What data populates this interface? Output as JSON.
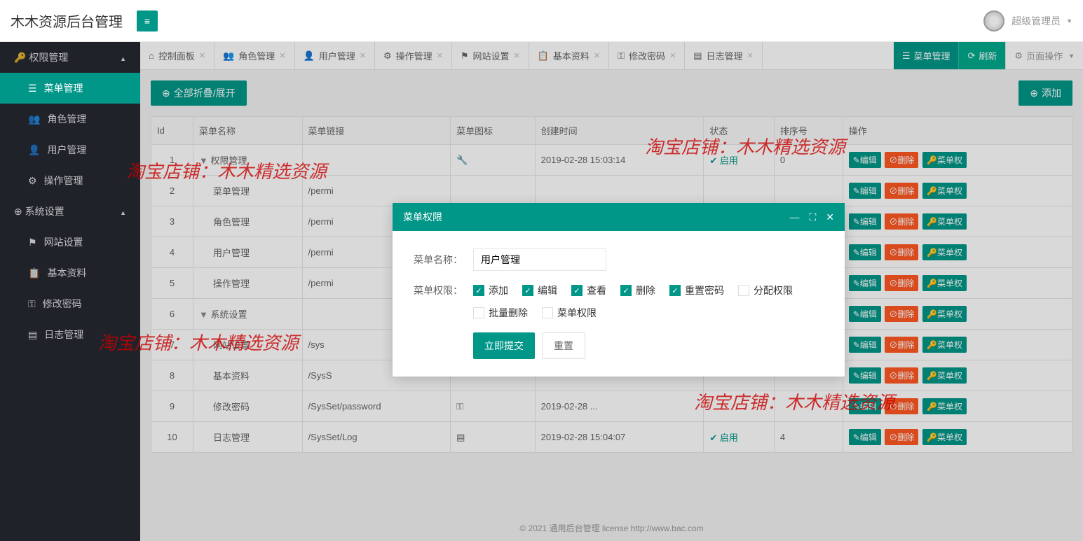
{
  "header": {
    "logo": "木木资源后台管理",
    "user": "超级管理员"
  },
  "sidebar": {
    "group1": {
      "label": "权限管理"
    },
    "items1": [
      {
        "label": "菜单管理",
        "active": true
      },
      {
        "label": "角色管理"
      },
      {
        "label": "用户管理"
      },
      {
        "label": "操作管理"
      }
    ],
    "group2": {
      "label": "系统设置"
    },
    "items2": [
      {
        "label": "网站设置"
      },
      {
        "label": "基本资料"
      },
      {
        "label": "修改密码"
      },
      {
        "label": "日志管理"
      }
    ]
  },
  "tabs": {
    "items": [
      {
        "icon": "⌂",
        "label": "控制面板"
      },
      {
        "icon": "👥",
        "label": "角色管理"
      },
      {
        "icon": "👤",
        "label": "用户管理"
      },
      {
        "icon": "⚙",
        "label": "操作管理"
      },
      {
        "icon": "⚑",
        "label": "网站设置"
      },
      {
        "icon": "📋",
        "label": "基本资料"
      },
      {
        "icon": "⚿",
        "label": "修改密码"
      },
      {
        "icon": "▤",
        "label": "日志管理"
      }
    ],
    "right": {
      "menu_mgmt": "菜单管理",
      "refresh": "刷新",
      "page_ops": "页面操作"
    }
  },
  "toolbar": {
    "collapse": "全部折叠/展开",
    "add": "添加"
  },
  "table": {
    "headers": {
      "id": "Id",
      "name": "菜单名称",
      "link": "菜单链接",
      "icon": "菜单图标",
      "created": "创建时间",
      "status": "状态",
      "sort": "排序号",
      "ops": "操作"
    },
    "rows": [
      {
        "id": "1",
        "caret": "▼",
        "indent": 0,
        "name": "权限管理",
        "link": "",
        "icon": "🔧",
        "created": "2019-02-28 15:03:14",
        "status": "启用",
        "sort": "0"
      },
      {
        "id": "2",
        "caret": "",
        "indent": 1,
        "name": "菜单管理",
        "link": "/permi",
        "icon": "",
        "created": "",
        "status": "",
        "sort": ""
      },
      {
        "id": "3",
        "caret": "",
        "indent": 1,
        "name": "角色管理",
        "link": "/permi",
        "icon": "",
        "created": "",
        "status": "",
        "sort": ""
      },
      {
        "id": "4",
        "caret": "",
        "indent": 1,
        "name": "用户管理",
        "link": "/permi",
        "icon": "",
        "created": "",
        "status": "",
        "sort": ""
      },
      {
        "id": "5",
        "caret": "",
        "indent": 1,
        "name": "操作管理",
        "link": "/permi",
        "icon": "",
        "created": "",
        "status": "",
        "sort": ""
      },
      {
        "id": "6",
        "caret": "▼",
        "indent": 0,
        "name": "系统设置",
        "link": "",
        "icon": "",
        "created": "",
        "status": "",
        "sort": ""
      },
      {
        "id": "7",
        "caret": "",
        "indent": 1,
        "name": "网站设置",
        "link": "/sys",
        "icon": "",
        "created": "",
        "status": "",
        "sort": ""
      },
      {
        "id": "8",
        "caret": "",
        "indent": 1,
        "name": "基本资料",
        "link": "/SysS",
        "icon": "",
        "created": "",
        "status": "",
        "sort": ""
      },
      {
        "id": "9",
        "caret": "",
        "indent": 1,
        "name": "修改密码",
        "link": "/SysSet/password",
        "icon": "⚿",
        "created": "2019-02-28 ...",
        "status": "",
        "sort": ""
      },
      {
        "id": "10",
        "caret": "",
        "indent": 1,
        "name": "日志管理",
        "link": "/SysSet/Log",
        "icon": "▤",
        "created": "2019-02-28 15:04:07",
        "status": "启用",
        "sort": "4"
      }
    ],
    "ops": {
      "edit": "编辑",
      "delete": "删除",
      "perm": "菜单权"
    }
  },
  "dialog": {
    "title": "菜单权限",
    "name_label": "菜单名称：",
    "name_value": "用户管理",
    "perm_label": "菜单权限：",
    "perms": [
      {
        "label": "添加",
        "checked": true
      },
      {
        "label": "编辑",
        "checked": true
      },
      {
        "label": "查看",
        "checked": true
      },
      {
        "label": "删除",
        "checked": true
      },
      {
        "label": "重置密码",
        "checked": true
      },
      {
        "label": "分配权限",
        "checked": false
      },
      {
        "label": "批量删除",
        "checked": false
      },
      {
        "label": "菜单权限",
        "checked": false
      }
    ],
    "submit": "立即提交",
    "reset": "重置"
  },
  "footer": {
    "text": "© 2021 通用后台管理 license  http://www.bac.com"
  },
  "watermark": "淘宝店铺：木木精选资源"
}
